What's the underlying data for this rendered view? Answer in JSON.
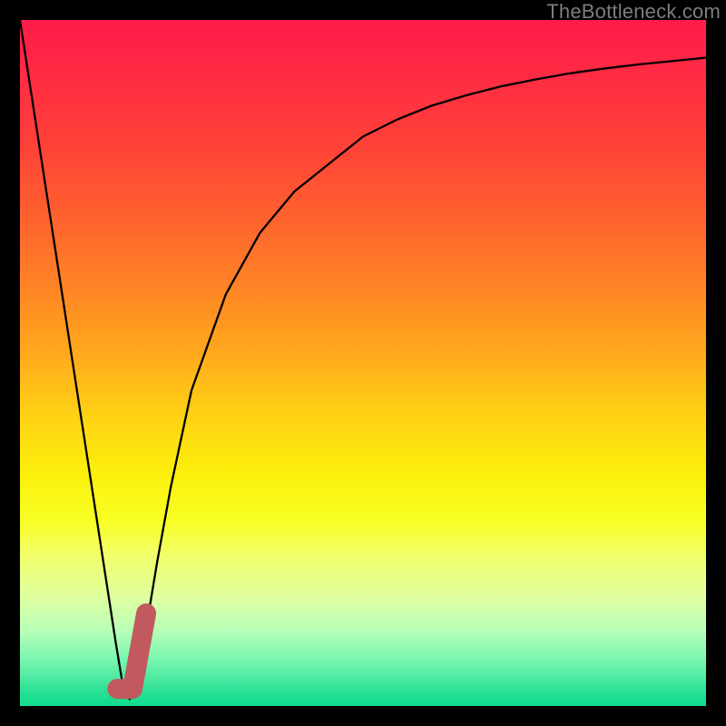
{
  "watermark": "TheBottleneck.com",
  "colors": {
    "frame": "#000000",
    "curve": "#000000",
    "marker": "#c1595e",
    "gradient_top": "#ff1b49",
    "gradient_bottom": "#10db8e"
  },
  "chart_data": {
    "type": "line",
    "title": "",
    "xlabel": "",
    "ylabel": "",
    "xlim": [
      0,
      100
    ],
    "ylim": [
      0,
      100
    ],
    "x": [
      0,
      2,
      4,
      6,
      8,
      10,
      12,
      14,
      15,
      16,
      17,
      18,
      20,
      22,
      25,
      30,
      35,
      40,
      45,
      50,
      55,
      60,
      65,
      70,
      75,
      80,
      85,
      90,
      95,
      100
    ],
    "values": [
      100,
      87,
      74,
      61,
      48,
      35,
      22,
      9,
      3,
      1,
      3,
      9,
      21,
      32,
      46,
      60,
      69,
      75,
      79,
      83,
      85.5,
      87.5,
      89,
      90.3,
      91.3,
      92.2,
      92.9,
      93.5,
      94,
      94.5
    ],
    "marker": {
      "points": [
        {
          "x": 14.2,
          "y": 2.5
        },
        {
          "x": 16.4,
          "y": 2.5
        },
        {
          "x": 18.4,
          "y": 13.5
        }
      ]
    },
    "annotations": []
  }
}
